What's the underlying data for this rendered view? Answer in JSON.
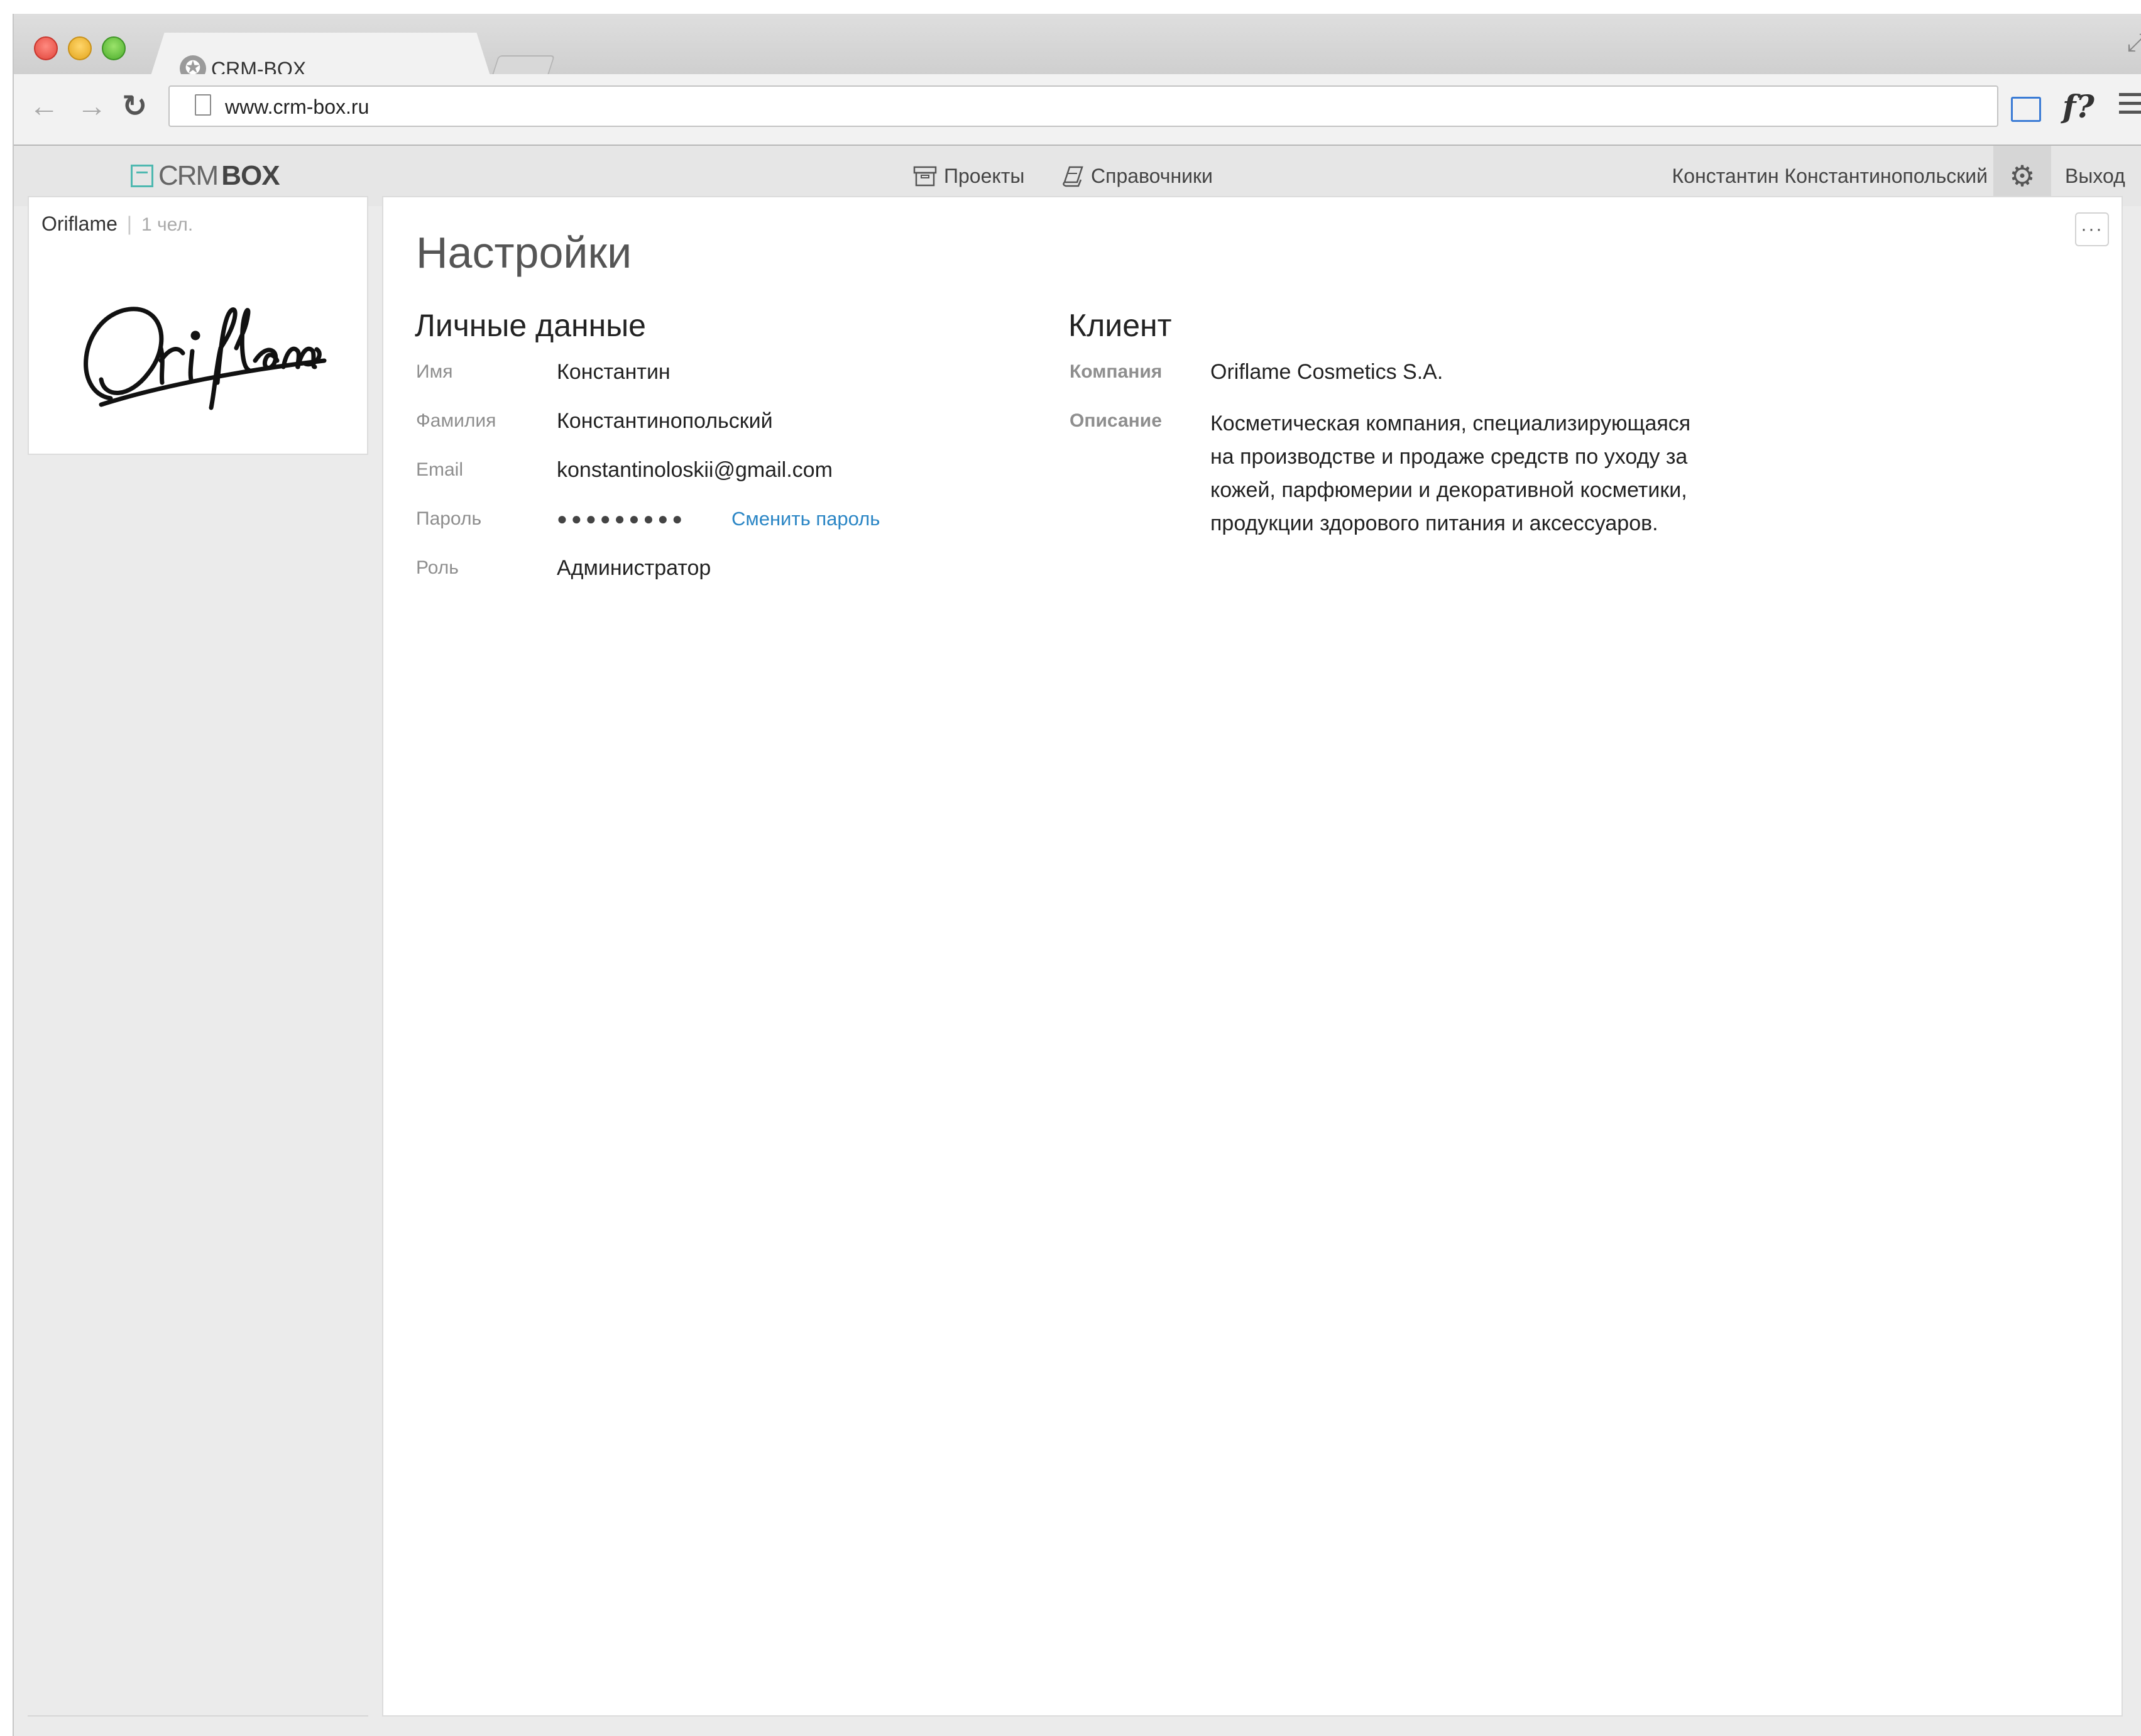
{
  "browser": {
    "tab_title": "CRM-BOX",
    "url": "www.crm-box.ru",
    "ext_font_label": "f?"
  },
  "app": {
    "logo_crm": "CRM",
    "logo_box": "BOX",
    "nav": {
      "projects": "Проекты",
      "references": "Справочники"
    },
    "user_name": "Константин Константинопольский",
    "logout": "Выход"
  },
  "sidebar": {
    "client_name": "Oriflame",
    "separator": "|",
    "member_count": "1 чел."
  },
  "page": {
    "title": "Настройки",
    "more_label": "···",
    "personal": {
      "title": "Личные данные",
      "name_label": "Имя",
      "name_value": "Константин",
      "surname_label": "Фамилия",
      "surname_value": "Константинопольский",
      "email_label": "Email",
      "email_value": "konstantinoloskii@gmail.com",
      "password_label": "Пароль",
      "password_value": "●●●●●●●●●",
      "change_password": "Сменить пароль",
      "role_label": "Роль",
      "role_value": "Администратор"
    },
    "client": {
      "title": "Клиент",
      "company_label": "Компания",
      "company_value": "Oriflame Cosmetics S.A.",
      "description_label": "Описание",
      "description_value": "Косметическая компания, специализирующаяся на производстве и продаже средств по уходу за кожей, парфюмерии и декоративной косметики, продукции здорового питания и аксессуаров."
    }
  },
  "icons": {
    "projects": "archive-box-icon",
    "references": "book-icon",
    "settings": "gear-icon",
    "more": "ellipsis-icon"
  },
  "colors": {
    "link": "#2b86c5",
    "logo_accent": "#4eb8b0"
  }
}
